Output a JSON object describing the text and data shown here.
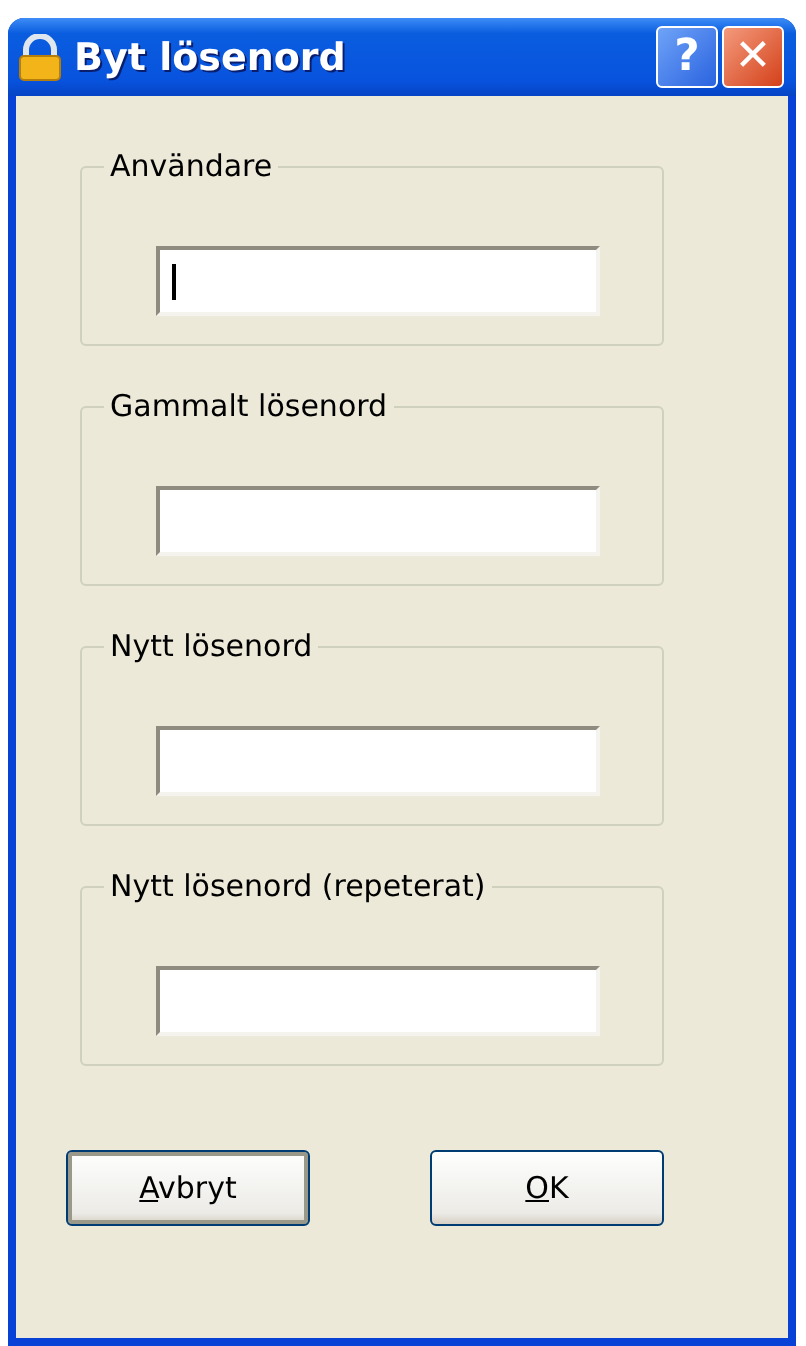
{
  "window": {
    "title": "Byt lösenord"
  },
  "title_buttons": [
    {
      "kind": "help",
      "label": "?"
    },
    {
      "kind": "close",
      "label": "✕"
    }
  ],
  "groups": [
    {
      "label": "Användare",
      "focused": true
    },
    {
      "label": "Gammalt lösenord",
      "focused": false
    },
    {
      "label": "Nytt lösenord",
      "focused": false
    },
    {
      "label": "Nytt lösenord (repeterat)",
      "focused": false
    }
  ],
  "buttons": [
    {
      "label": "Avbryt",
      "mnemonic": true,
      "default": true
    },
    {
      "label": "OK",
      "mnemonic": true,
      "default": false
    }
  ]
}
